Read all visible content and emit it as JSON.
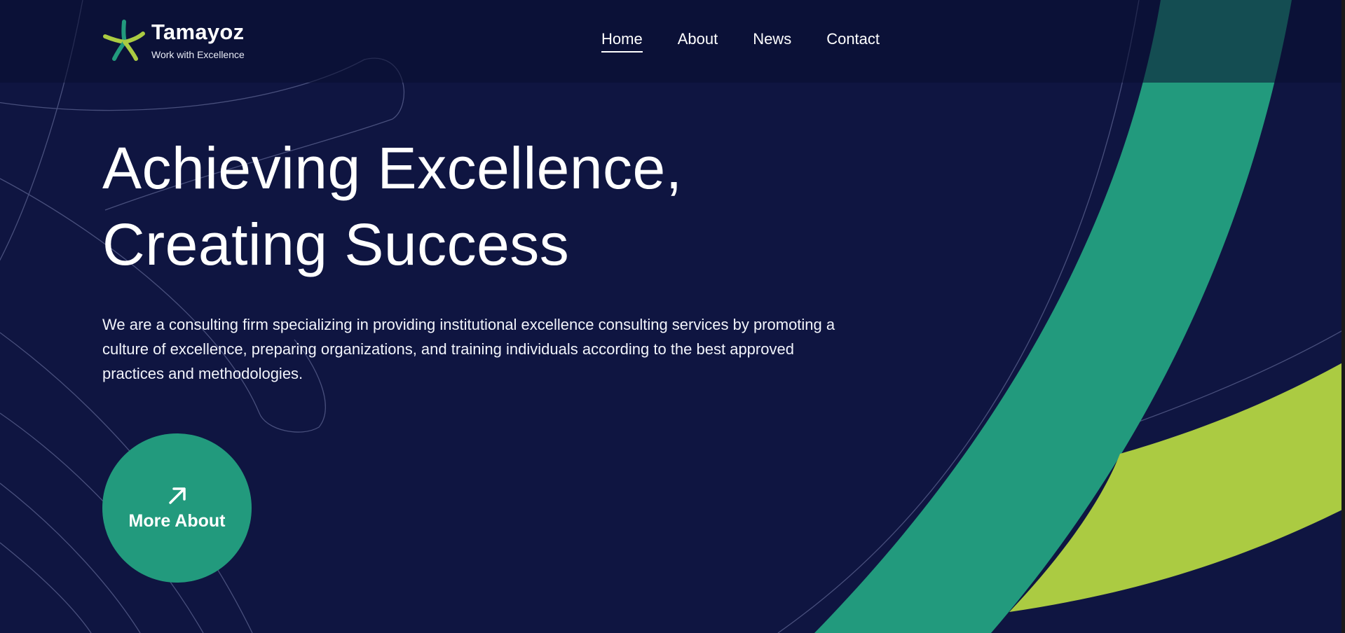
{
  "brand": {
    "name": "Tamayoz",
    "tagline": "Work with Excellence",
    "logo_icon": "star-logo-icon"
  },
  "nav": {
    "items": [
      {
        "label": "Home",
        "active": true
      },
      {
        "label": "About",
        "active": false
      },
      {
        "label": "News",
        "active": false
      },
      {
        "label": "Contact",
        "active": false
      }
    ]
  },
  "hero": {
    "title_line1": "Achieving Excellence,",
    "title_line2": "Creating Success",
    "description": "We are a consulting firm specializing in providing institutional excellence consulting services by promoting a culture of excellence, preparing organizations, and training individuals according to the best approved practices and methodologies.",
    "cta_label": "More About",
    "cta_icon": "arrow-up-right-icon"
  },
  "colors": {
    "background": "#0f1541",
    "accent_green": "#229a7d",
    "accent_lime": "#abcb42",
    "text": "#ffffff"
  }
}
